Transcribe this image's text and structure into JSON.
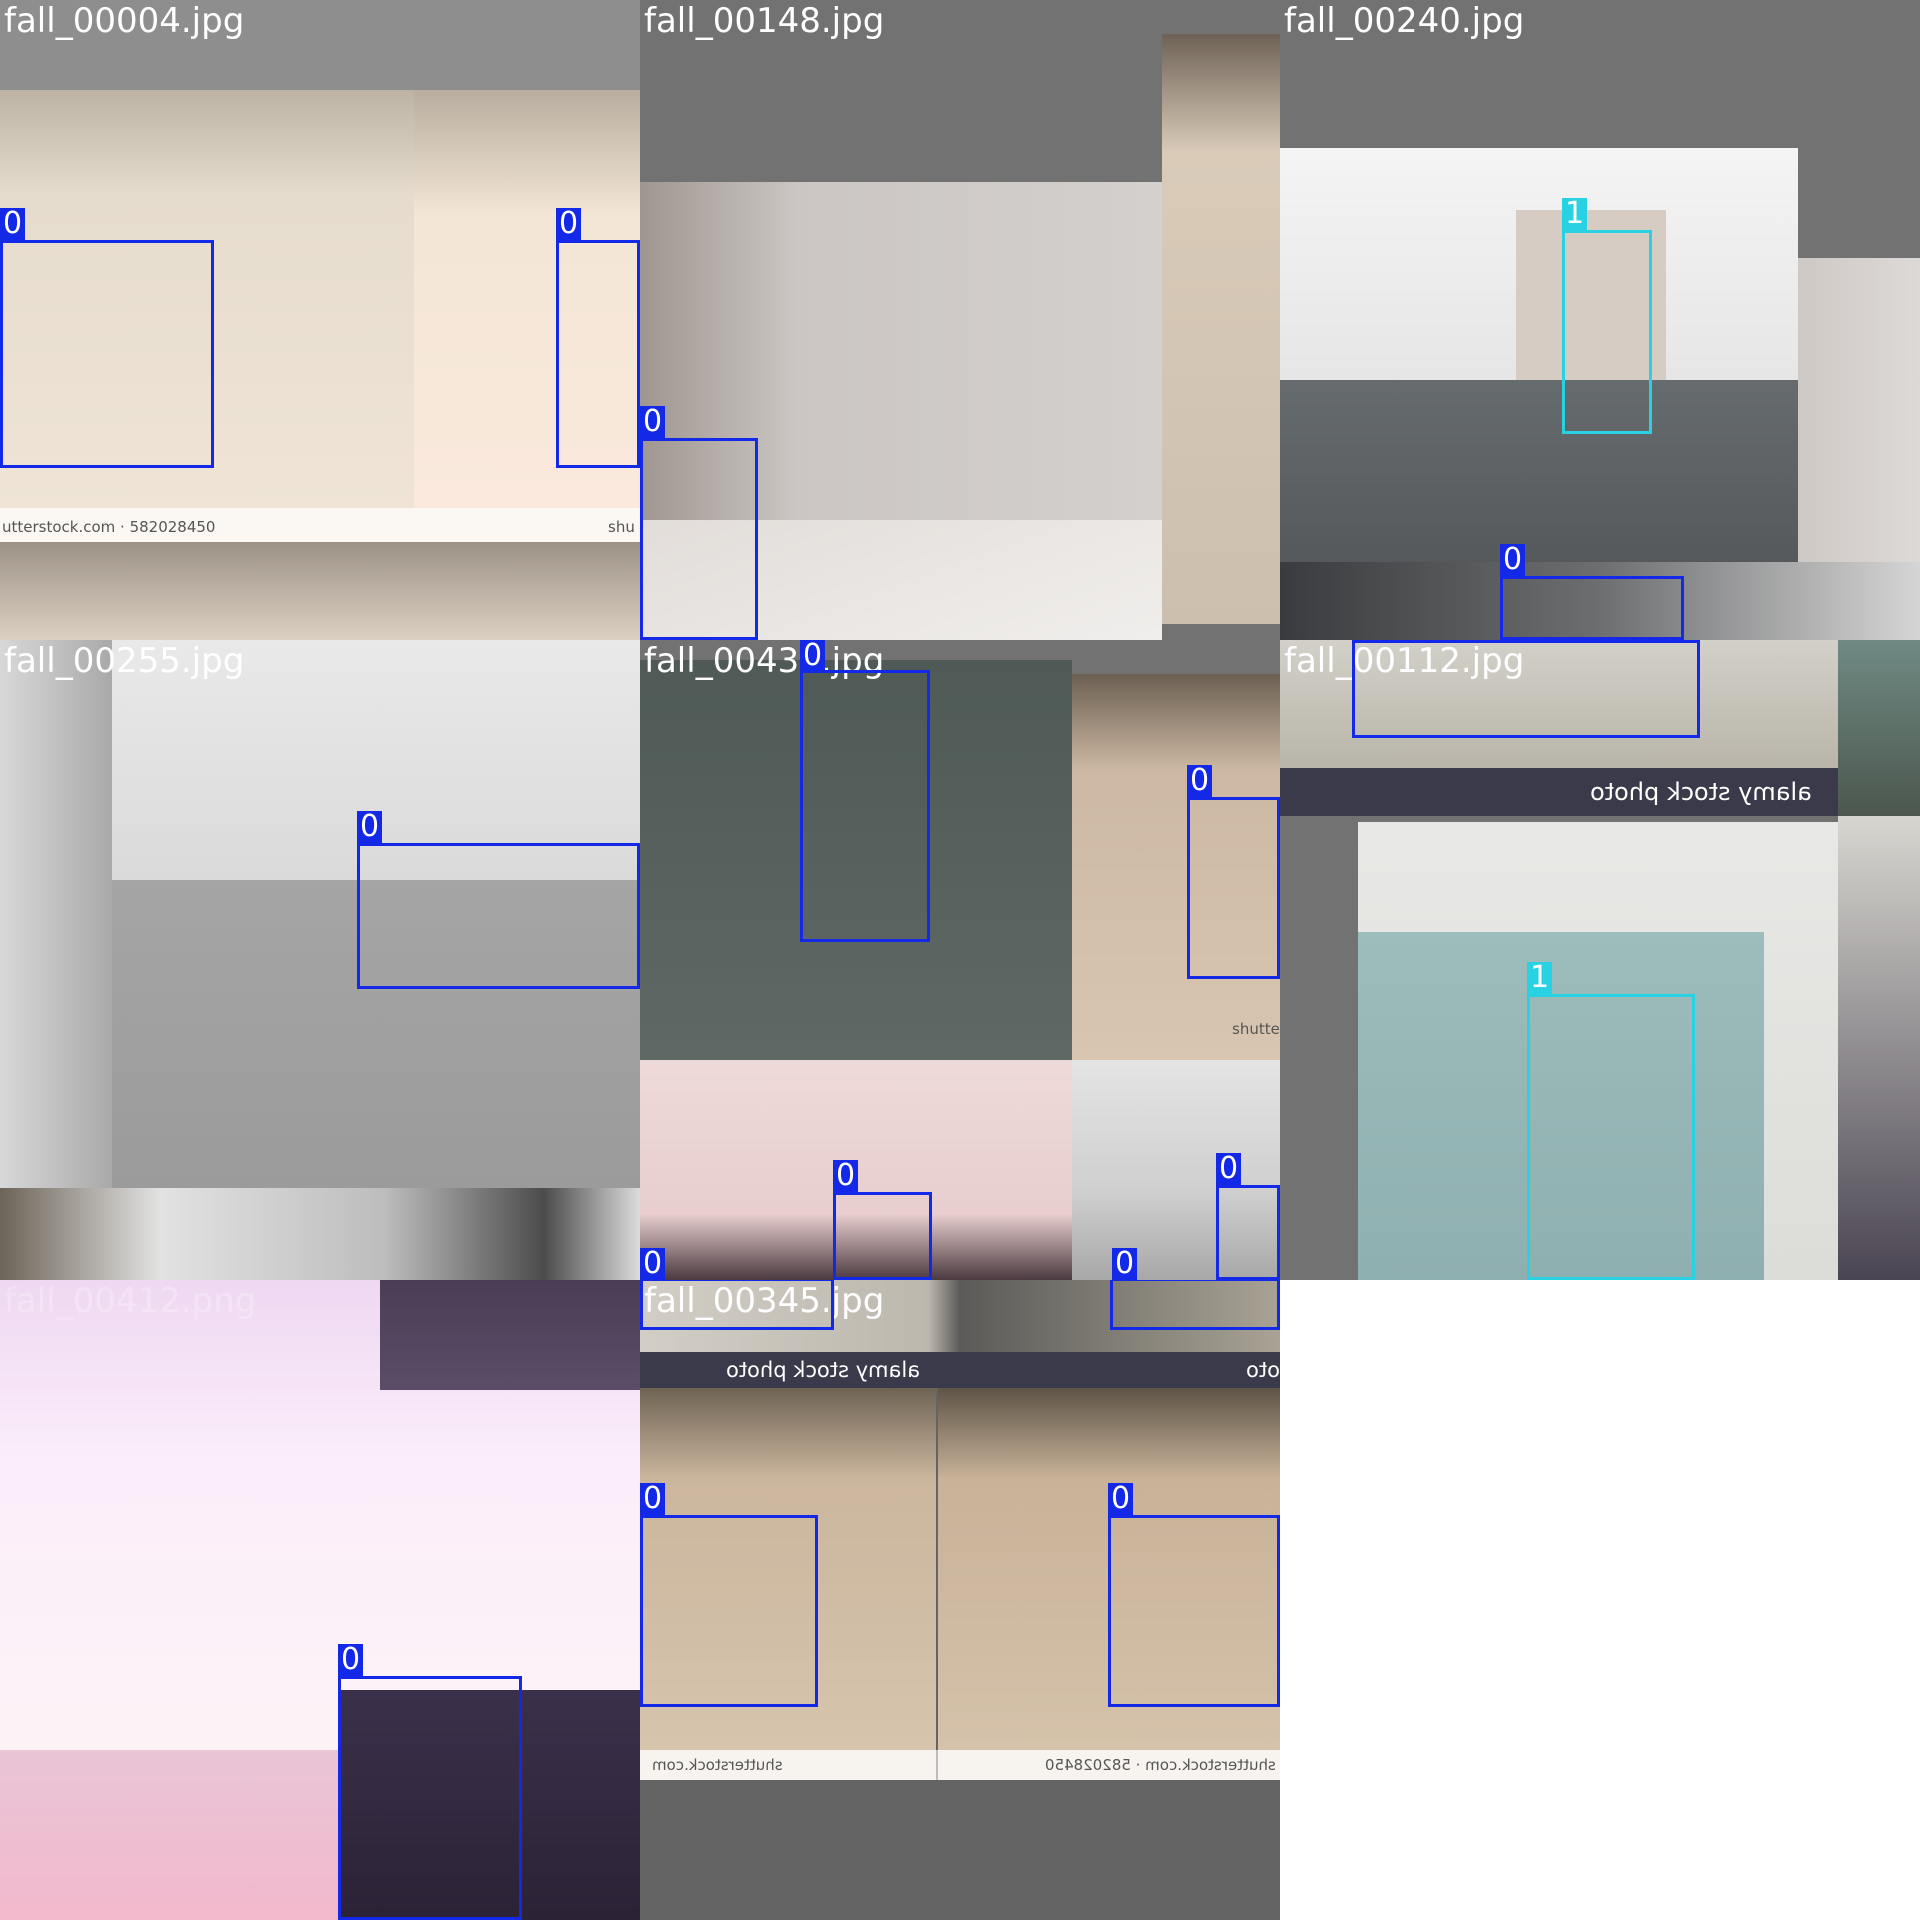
{
  "mosaic": {
    "filenames": [
      "fall_00004.jpg",
      "fall_00148.jpg",
      "fall_00240.jpg",
      "fall_00255.jpg",
      "fall_00439.jpg",
      "fall_00112.jpg",
      "fall_00412.png",
      "fall_00345.jpg"
    ],
    "class_labels": [
      "0",
      "1"
    ],
    "watermarks": {
      "shutterstock_1": "utterstock.com · 582028450",
      "shutterstock_2": "shu",
      "shutterstock_3": "shutter",
      "alamy": "alamy stock photo",
      "alamy_short": "oto",
      "shutterstock_mirror": "shutterstock.com",
      "shutterstock_mirror_2": "shutterstock.com · 582028450"
    }
  },
  "colors": {
    "class_0_box": "#1428e8",
    "class_1_box": "#28d2e2",
    "letterbox_gray": "#727272",
    "page_background": "#ffffff"
  }
}
